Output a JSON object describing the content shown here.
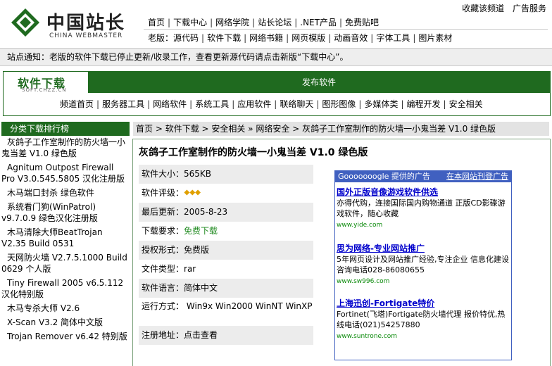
{
  "header": {
    "logo_cn": "中国站长",
    "logo_en": "CHINA WEBMASTER",
    "top_links": [
      "收藏该频道",
      "广告服务"
    ],
    "nav1": [
      "首页",
      "下载中心",
      "网络学院",
      "站长论坛",
      ".NET产品",
      "免费贴吧"
    ],
    "nav2_prefix": "老版：",
    "nav2": [
      "源代码",
      "软件下载",
      "网络书籍",
      "网页模版",
      "动画音效",
      "字体工具",
      "图片素材"
    ]
  },
  "notice": "站点通知：老版的软件下载已停止更新/收录工作，查看更新源代码请点击新版“下载中心”。",
  "soft": {
    "logo_title": "软件下载",
    "logo_sub": "SOFT.CHZZ.CN",
    "publish": "发布软件",
    "nav": [
      "频道首页",
      "服务器工具",
      "网络软件",
      "系统工具",
      "应用软件",
      "联络聊天",
      "图形图像",
      "多媒体类",
      "编程开发",
      "安全相关"
    ]
  },
  "sidebar": {
    "title": "分类下载排行榜",
    "items": [
      "灰鸽子工作室制作的防火墙一小鬼当差 V1.0 绿色版",
      "Agnitum Outpost Firewall Pro V3.0.545.5805 汉化注册版",
      "木马端口封杀 绿色软件",
      "系统看门狗(WinPatrol) v9.7.0.9 绿色汉化注册版",
      "木马清除大师BeatTrojan V2.35 Build 0531",
      "天网防火墙 V2.7.5.1000 Build 0629 个人版",
      "Tiny Firewall 2005 v6.5.112 汉化特别版",
      "木马专杀大师 V2.6",
      "X-Scan V3.2 简体中文版",
      "Trojan Remover v6.42 特别版"
    ]
  },
  "breadcrumb": [
    "首页",
    "软件下载",
    "安全相关",
    "网络安全",
    "灰鸽子工作室制作的防火墙一小鬼当差 V1.0 绿色版"
  ],
  "detail": {
    "title": "灰鸽子工作室制作的防火墙一小鬼当差 V1.0 绿色版",
    "size_label": "软件大小：",
    "size": "565KB",
    "rating_label": "软件评级：",
    "rating": 3,
    "updated_label": "最后更新：",
    "updated": "2005-8-23",
    "require_label": "下载要求：",
    "require": "免费下载",
    "license_label": "授权形式：",
    "license": "免费版",
    "type_label": "文件类型：",
    "type": "rar",
    "lang_label": "软件语言：",
    "lang": "简体中文",
    "env_label": "运行方式：",
    "env": "Win9x Win2000 WinNT WinXP",
    "reg_label": "注册地址：",
    "reg": "点击查看"
  },
  "ad": {
    "head_left": "Gooooooogle 提供的广告",
    "head_right": "在本网站刊登广告",
    "items": [
      {
        "title": "国外正版音像游戏软件供选",
        "desc": "亦得代购，连接国际国内购物通道 正版CD影碟游戏软件，随心收藏",
        "url": "www.yide.com"
      },
      {
        "title": "思为网络-专业网站推广",
        "desc": "5年网页设计及网站推广经验,专注企业 信息化建设 咨询电话028-86080655",
        "url": "www.sw996.com"
      },
      {
        "title": "上海迅创-Fortigate特价",
        "desc": "Fortinet(飞塔)Fortigate防火墙代理 报价特优,热线电话(021)54257880",
        "url": "www.suntrone.com"
      }
    ]
  },
  "colors": {
    "brand_green": "#1f6a1f",
    "ad_blue": "#4060c0",
    "link_blue": "#0000cc"
  }
}
